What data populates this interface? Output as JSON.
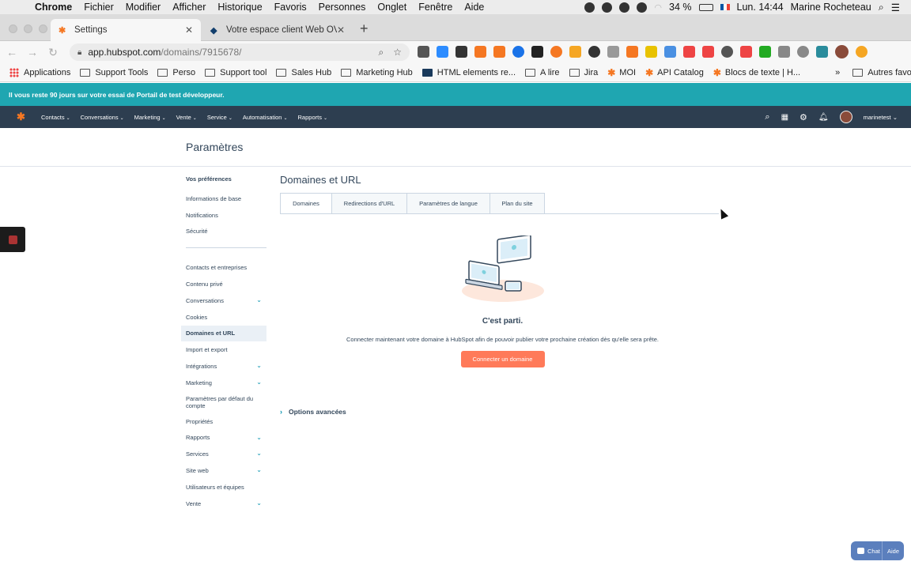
{
  "mac_menu": {
    "app": "Chrome",
    "items": [
      "Fichier",
      "Modifier",
      "Afficher",
      "Historique",
      "Favoris",
      "Personnes",
      "Onglet",
      "Fenêtre",
      "Aide"
    ],
    "battery": "34 %",
    "clock": "Lun. 14:44",
    "user": "Marine Rocheteau"
  },
  "browser": {
    "tabs": [
      {
        "title": "Settings"
      },
      {
        "title": "Votre espace client Web OVHcl"
      }
    ],
    "url_host": "app.hubspot.com",
    "url_path": "/domains/7915678/",
    "bookmarks": [
      "Applications",
      "Support Tools",
      "Perso",
      "Support tool",
      "Sales Hub",
      "Marketing Hub",
      "HTML elements re...",
      "A lire",
      "Jira",
      "MOI",
      "API Catalog",
      "Blocs de texte | H..."
    ],
    "bookmarks_more": "»",
    "other_bookmarks": "Autres favoris"
  },
  "trial_banner": "Il vous reste 90 jours sur votre essai de Portail de test développeur.",
  "hs_nav": {
    "items": [
      "Contacts",
      "Conversations",
      "Marketing",
      "Vente",
      "Service",
      "Automatisation",
      "Rapports"
    ],
    "account": "marinetest"
  },
  "page": {
    "title": "Paramètres"
  },
  "sidebar": {
    "section_title": "Vos préférences",
    "pref_items": [
      "Informations de base",
      "Notifications",
      "Sécurité"
    ],
    "account_items": [
      {
        "label": "Contacts et entreprises",
        "expandable": false
      },
      {
        "label": "Contenu privé",
        "expandable": false
      },
      {
        "label": "Conversations",
        "expandable": true
      },
      {
        "label": "Cookies",
        "expandable": false
      },
      {
        "label": "Domaines et URL",
        "expandable": false,
        "active": true
      },
      {
        "label": "Import et export",
        "expandable": false
      },
      {
        "label": "Intégrations",
        "expandable": true
      },
      {
        "label": "Marketing",
        "expandable": true
      },
      {
        "label": "Paramètres par défaut du compte",
        "expandable": false
      },
      {
        "label": "Propriétés",
        "expandable": false
      },
      {
        "label": "Rapports",
        "expandable": true
      },
      {
        "label": "Services",
        "expandable": true
      },
      {
        "label": "Site web",
        "expandable": true
      },
      {
        "label": "Utilisateurs et équipes",
        "expandable": false
      },
      {
        "label": "Vente",
        "expandable": true
      }
    ]
  },
  "main": {
    "title": "Domaines et URL",
    "tabs": [
      "Domaines",
      "Redirections d'URL",
      "Paramètres de langue",
      "Plan du site"
    ],
    "empty_title": "C'est parti.",
    "empty_desc": "Connecter maintenant votre domaine à HubSpot afin de pouvoir publier votre prochaine création dès qu'elle sera prête.",
    "cta": "Connecter un domaine",
    "advanced": "Options avancées"
  },
  "chat_widget": {
    "chat": "Chat",
    "help": "Aide"
  },
  "colors": {
    "teal": "#1fa6b1",
    "navy": "#2d3e50",
    "orange": "#ff7a59",
    "link": "#0091ae"
  }
}
